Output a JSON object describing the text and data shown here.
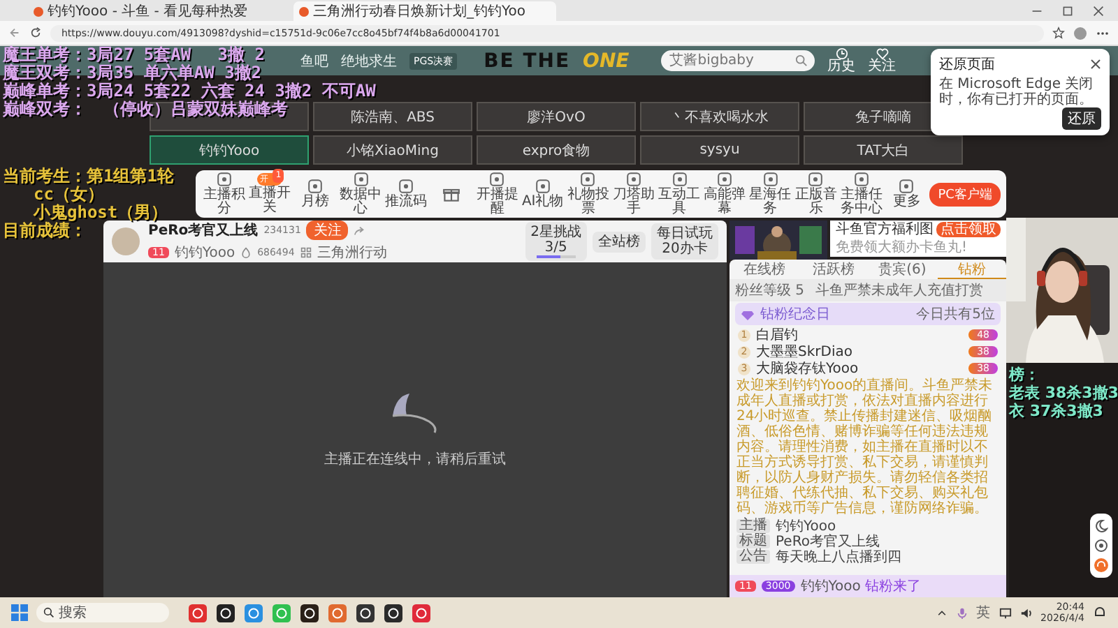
{
  "browser": {
    "tabs": [
      {
        "title": "钓钓Yooo - 斗鱼 - 看见每种热爱",
        "selected": false
      },
      {
        "title": "三角洲行动春日焕新计划_钓钓Yoo",
        "selected": true
      }
    ],
    "url": "https://www.douyu.com/4913098?dyshid=c15751d-9c06e7cc8o45bf74f4b8a6d00041701"
  },
  "overlay": {
    "lines": [
      {
        "kind": "score",
        "text": "魔王单考：3局27 5套AW　 3撤 2",
        "color": "#dba8ee"
      },
      {
        "kind": "score",
        "text": "魔王双考：3局35 单六单AW 3撤2",
        "color": "#dba8ee"
      },
      {
        "kind": "score",
        "text": "巅峰单考：3局24 5套22 六套 24 3撤2 不可AW",
        "color": "#dba8ee"
      },
      {
        "kind": "score",
        "text": "巅峰双考：　（停收）吕蒙双妹巅峰考",
        "color": "#dba8ee"
      },
      {
        "kind": "heading",
        "text": "当前考生：第1组第1轮",
        "color": "#e6c23a"
      },
      {
        "kind": "candidate",
        "text": "cc（女）",
        "color": "#e6c23a"
      },
      {
        "kind": "candidate",
        "text": "小鬼ghost（男）",
        "color": "#e6c23a"
      },
      {
        "kind": "score",
        "text": "目前成绩：",
        "color": "#e6c23a"
      }
    ],
    "right": [
      "榜：",
      "老表 38杀3撤3",
      "衣 37杀3撤3"
    ]
  },
  "header": {
    "nav": [
      "鱼吧",
      "绝地求生"
    ],
    "promo": "PGS决赛",
    "banner": [
      "BE THE",
      "ONE"
    ],
    "search": {
      "placeholder": "艾酱bigbaby"
    },
    "actions": [
      "历史",
      "关注"
    ]
  },
  "popup": {
    "title": "还原页面",
    "body": "在 Microsoft Edge 关闭时，你有已打开的页面。",
    "button": "还原"
  },
  "streamers": [
    {
      "kind": "covered",
      "selected": false
    },
    {
      "kind": "name",
      "name": "陈浩南、ABS",
      "selected": false
    },
    {
      "kind": "name",
      "name": "廖洋OvO",
      "selected": false
    },
    {
      "kind": "name",
      "name": "丶不喜欢喝水水",
      "selected": false
    },
    {
      "kind": "name",
      "name": "兔子嘀嘀",
      "selected": false
    },
    {
      "kind": "name",
      "name": "钓钓Yooo",
      "selected": true
    },
    {
      "kind": "name",
      "name": "小铭XiaoMing",
      "selected": false
    },
    {
      "kind": "name",
      "name": "expro食物",
      "selected": false
    },
    {
      "kind": "name",
      "name": "sysyu",
      "selected": false
    },
    {
      "kind": "name",
      "name": "TAT大白",
      "selected": false
    }
  ],
  "toolbar": {
    "items": [
      {
        "kind": "labeled",
        "label": "主播积分"
      },
      {
        "kind": "toggle",
        "label": "直播开关",
        "on": true,
        "toggle_text": "开",
        "badge": "1"
      },
      {
        "kind": "labeled",
        "label": "月榜"
      },
      {
        "kind": "labeled",
        "label": "数据中心"
      },
      {
        "kind": "labeled",
        "label": "推流码"
      },
      {
        "kind": "gift"
      },
      {
        "kind": "labeled",
        "label": "开播提醒"
      },
      {
        "kind": "labeled",
        "label": "AI礼物"
      },
      {
        "kind": "labeled",
        "label": "礼物投票"
      },
      {
        "kind": "labeled",
        "label": "刀塔助手"
      },
      {
        "kind": "labeled",
        "label": "互动工具"
      },
      {
        "kind": "labeled",
        "label": "高能弹幕"
      },
      {
        "kind": "labeled",
        "label": "星海任务"
      },
      {
        "kind": "labeled",
        "label": "正版音乐"
      },
      {
        "kind": "labeled",
        "label": "主播任务中心"
      },
      {
        "kind": "labeled",
        "label": "更多"
      }
    ],
    "pc_button": "PC客户端"
  },
  "room": {
    "title": "PeRo考官又上线",
    "room_id": "234131",
    "follow": "关注",
    "level": "11",
    "owner": "钓钓Yooo",
    "popularity": "686494",
    "category": "三角洲行动",
    "challenge": {
      "label": "2星挑战",
      "progress": "3/5",
      "level": 0.6
    },
    "rank": "全站榜",
    "trial": [
      "每日试玩",
      "20办卡"
    ]
  },
  "video": {
    "message": "主播正在连线中，请稍后重试"
  },
  "side": {
    "ad": {
      "title": "斗鱼官方福利图",
      "subtitle": "免费领大额办卡鱼丸!",
      "button": "点击领取"
    },
    "tabs": [
      {
        "label": "在线榜",
        "selected": false
      },
      {
        "label": "活跃榜",
        "selected": false
      },
      {
        "label": "贵宾(6)",
        "selected": false
      },
      {
        "label": "钻粉",
        "selected": true
      }
    ],
    "fan_level": "粉丝等级 5",
    "notice": "斗鱼严禁未成年人充值打赏",
    "anniversary": {
      "title": "钻粉纪念日",
      "note": "今日共有5位"
    },
    "fans": [
      {
        "rank": "1",
        "name": "白眉钓",
        "badge": "48"
      },
      {
        "rank": "2",
        "name": "大墨墨SkrDiao",
        "badge": "38"
      },
      {
        "rank": "3",
        "name": "大脑袋存钛Yooo",
        "badge": "38"
      }
    ],
    "welcome": "欢迎来到钓钓Yooo的直播间。斗鱼严禁未成年人直播或打赏，依法对直播内容进行24小时巡查。禁止传播封建迷信、吸烟酗酒、低俗色情、赌博诈骗等任何违法违规内容。请理性消费，如主播在直播时以不正当方式诱导打赏、私下交易，请谨慎判断，以防人身财产损失。请勿轻信各类招聘征婚、代练代抽、私下交易、购买礼包码、游戏币等广告信息，谨防网络诈骗。",
    "info": [
      {
        "label": "主播",
        "value": "钓钓Yooo"
      },
      {
        "label": "标题",
        "value": "PeRo考官又上线"
      },
      {
        "label": "公告",
        "value": "每天晚上八点播到四"
      }
    ],
    "entry": {
      "level": "11",
      "badge": "3000",
      "user": "钓钓Yooo",
      "action": "钻粉来了"
    }
  },
  "taskbar": {
    "search": "搜索",
    "lang": "英",
    "time": "20:44",
    "date": "2026/4/4"
  }
}
